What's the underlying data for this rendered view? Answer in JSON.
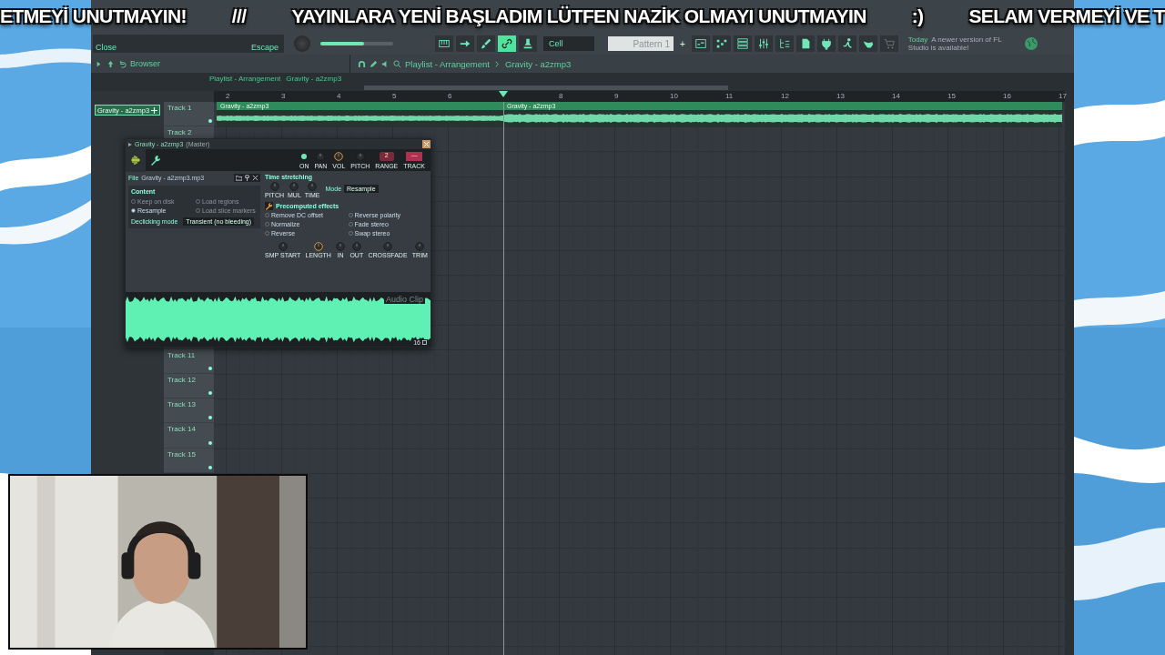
{
  "banner": {
    "segments": [
      "ETMEYİ UNUTMAYIN!",
      "///",
      "YAYINLARA YENİ BAŞLADIM LÜTFEN NAZİK OLMAYI UNUTMAYIN",
      ":)",
      "SELAM VERMEYİ VE T"
    ]
  },
  "toolbar": {
    "hint": {
      "title": "Close",
      "shortcut": "Escape"
    },
    "master_volume": {
      "level": 0.6
    },
    "tools": [
      {
        "selected": false
      },
      {
        "selected": false
      },
      {
        "selected": false
      },
      {
        "selected": true
      },
      {
        "selected": false
      }
    ],
    "snap": "Cell",
    "pattern": "Pattern 1",
    "pattern_add": "+",
    "news": {
      "date": "Today",
      "message": "A newer version of FL Studio is available!"
    }
  },
  "browser": {
    "title": "Browser"
  },
  "playlist": {
    "title": "Playlist - Arrangement",
    "pattern": "Gravity - a2zmp3",
    "window_title": "Playlist - Arrangement",
    "window_pattern": "Gravity - a2zmp3",
    "picker_item": "Gravity - a2zmp3",
    "ruler": [
      {
        "label": "2",
        "playhead": false
      },
      {
        "label": "3",
        "playhead": false
      },
      {
        "label": "4",
        "playhead": false
      },
      {
        "label": "5",
        "playhead": false
      },
      {
        "label": "6",
        "playhead": false
      },
      {
        "playhead": true
      },
      {
        "label": "8",
        "playhead": false
      },
      {
        "label": "9",
        "playhead": false
      },
      {
        "label": "10",
        "playhead": false
      },
      {
        "label": "11",
        "playhead": false
      },
      {
        "label": "12",
        "playhead": false
      },
      {
        "label": "13",
        "playhead": false
      },
      {
        "label": "14",
        "playhead": false
      },
      {
        "label": "15",
        "playhead": false
      },
      {
        "label": "16",
        "playhead": false
      },
      {
        "label": "17",
        "playhead": false
      }
    ],
    "tracks_top": [
      "Track 1",
      "Track 2"
    ],
    "tracks_bottom": [
      "Track 11",
      "Track 12",
      "Track 13",
      "Track 14",
      "Track 15"
    ],
    "clips": [
      "Gravity - a2zmp3",
      "Gravity - a2zmp3"
    ]
  },
  "sampler": {
    "title": "Gravity - a2zmp3",
    "target": "(Master)",
    "top_knobs": [
      {
        "label": "ON",
        "kind": "led",
        "on": true
      },
      {
        "label": "PAN",
        "kind": "knob"
      },
      {
        "label": "VOL",
        "kind": "knob",
        "highlighted": true
      },
      {
        "label": "PITCH",
        "kind": "knob"
      },
      {
        "label": "RANGE",
        "kind": "value",
        "value": "2"
      },
      {
        "label": "TRACK",
        "kind": "track",
        "value": "—"
      }
    ],
    "file_label": "File",
    "file": "Gravity - a2zmp3.mp3",
    "content_title": "Content",
    "content_options": [
      {
        "label": "Keep on disk",
        "selected": false,
        "disabled": true
      },
      {
        "label": "Load regions",
        "selected": false,
        "disabled": true
      },
      {
        "label": "Resample",
        "selected": true,
        "disabled": false
      },
      {
        "label": "Load slice markers",
        "selected": false,
        "disabled": true
      }
    ],
    "declicking_label": "Declicking mode",
    "declicking": "Transient (no bleeding)",
    "stretch_title": "Time stretching",
    "stretch_knobs": [
      "PITCH",
      "MUL",
      "TIME"
    ],
    "mode_label": "Mode",
    "mode": "Resample",
    "effects_title": "Precomputed effects",
    "effects": [
      {
        "label": "Remove DC offset",
        "checked": false
      },
      {
        "label": "Reverse polarity",
        "checked": false
      },
      {
        "label": "Normalize",
        "checked": false
      },
      {
        "label": "Fade stereo",
        "checked": false
      },
      {
        "label": "Reverse",
        "checked": false
      },
      {
        "label": "Swap stereo",
        "checked": false
      }
    ],
    "bottom_knobs": [
      {
        "label": "SMP START",
        "highlighted": false
      },
      {
        "label": "LENGTH",
        "highlighted": true
      },
      {
        "label": "IN",
        "highlighted": false
      },
      {
        "label": "OUT",
        "highlighted": false
      },
      {
        "label": "CROSSFADE",
        "highlighted": false
      },
      {
        "label": "TRIM",
        "highlighted": false
      }
    ],
    "wave_caption": "Audio Clip",
    "wave_count": "16"
  }
}
